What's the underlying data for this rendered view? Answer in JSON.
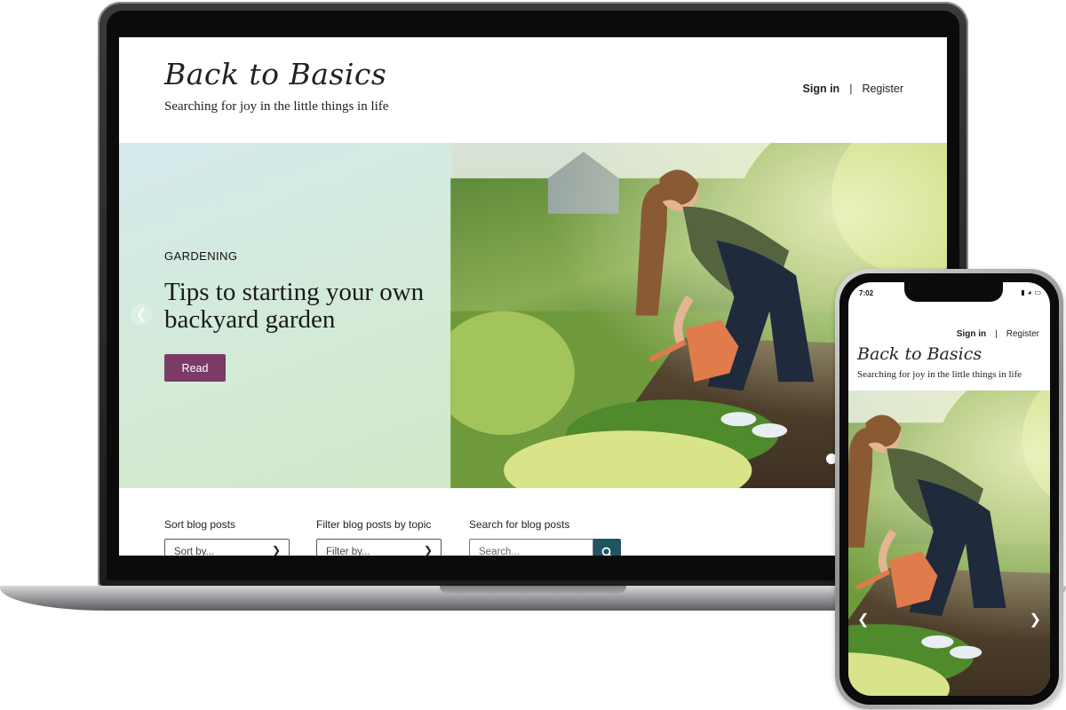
{
  "site": {
    "logo": "Back to Basics",
    "tagline": "Searching for joy in the little things in life",
    "sign_in": "Sign in",
    "separator": "|",
    "register": "Register"
  },
  "hero": {
    "category": "GARDENING",
    "title": "Tips to starting your own backyard garden",
    "read_button": "Read",
    "prev_icon": "chevron-left-icon",
    "slides_total": 2,
    "active_slide": 1
  },
  "controls": {
    "sort_label": "Sort blog posts",
    "sort_value": "Sort by...",
    "filter_label": "Filter blog posts by topic",
    "filter_value": "Filter by...",
    "search_label": "Search for blog posts",
    "search_placeholder": "Search..."
  },
  "phone": {
    "time": "7:02",
    "sign_in": "Sign in",
    "separator": "|",
    "register": "Register",
    "logo": "Back to Basics",
    "tagline": "Searching for joy in the little things in life"
  },
  "colors": {
    "accent_button": "#7b3a68",
    "search_button": "#1f5563"
  }
}
